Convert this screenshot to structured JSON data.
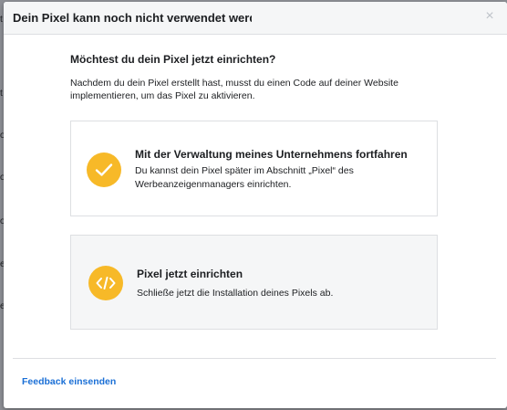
{
  "background": {
    "letters": [
      "t",
      "t",
      "o",
      "o",
      "o",
      "e",
      "e"
    ]
  },
  "modal": {
    "title": "Dein Pixel kann noch nicht verwendet werden",
    "close_symbol": "×",
    "heading": "Möchtest du dein Pixel jetzt einrichten?",
    "description": "Nachdem du dein Pixel erstellt hast, musst du einen Code auf deiner Website implementieren, um das Pixel zu aktivieren.",
    "options": [
      {
        "icon": "check-icon",
        "title": "Mit der Verwaltung meines Unternehmens fortfahren",
        "text": "Du kannst dein Pixel später im Abschnitt „Pixel“ des Werbeanzeigenmanagers einrichten."
      },
      {
        "icon": "code-icon",
        "title": "Pixel jetzt einrichten",
        "text": "Schließe jetzt die Installation deines Pixels ab."
      }
    ],
    "feedback_link": "Feedback einsenden"
  },
  "colors": {
    "icon_background": "#f7b928",
    "link": "#1a6fd6",
    "overlay": "#8e9096"
  }
}
